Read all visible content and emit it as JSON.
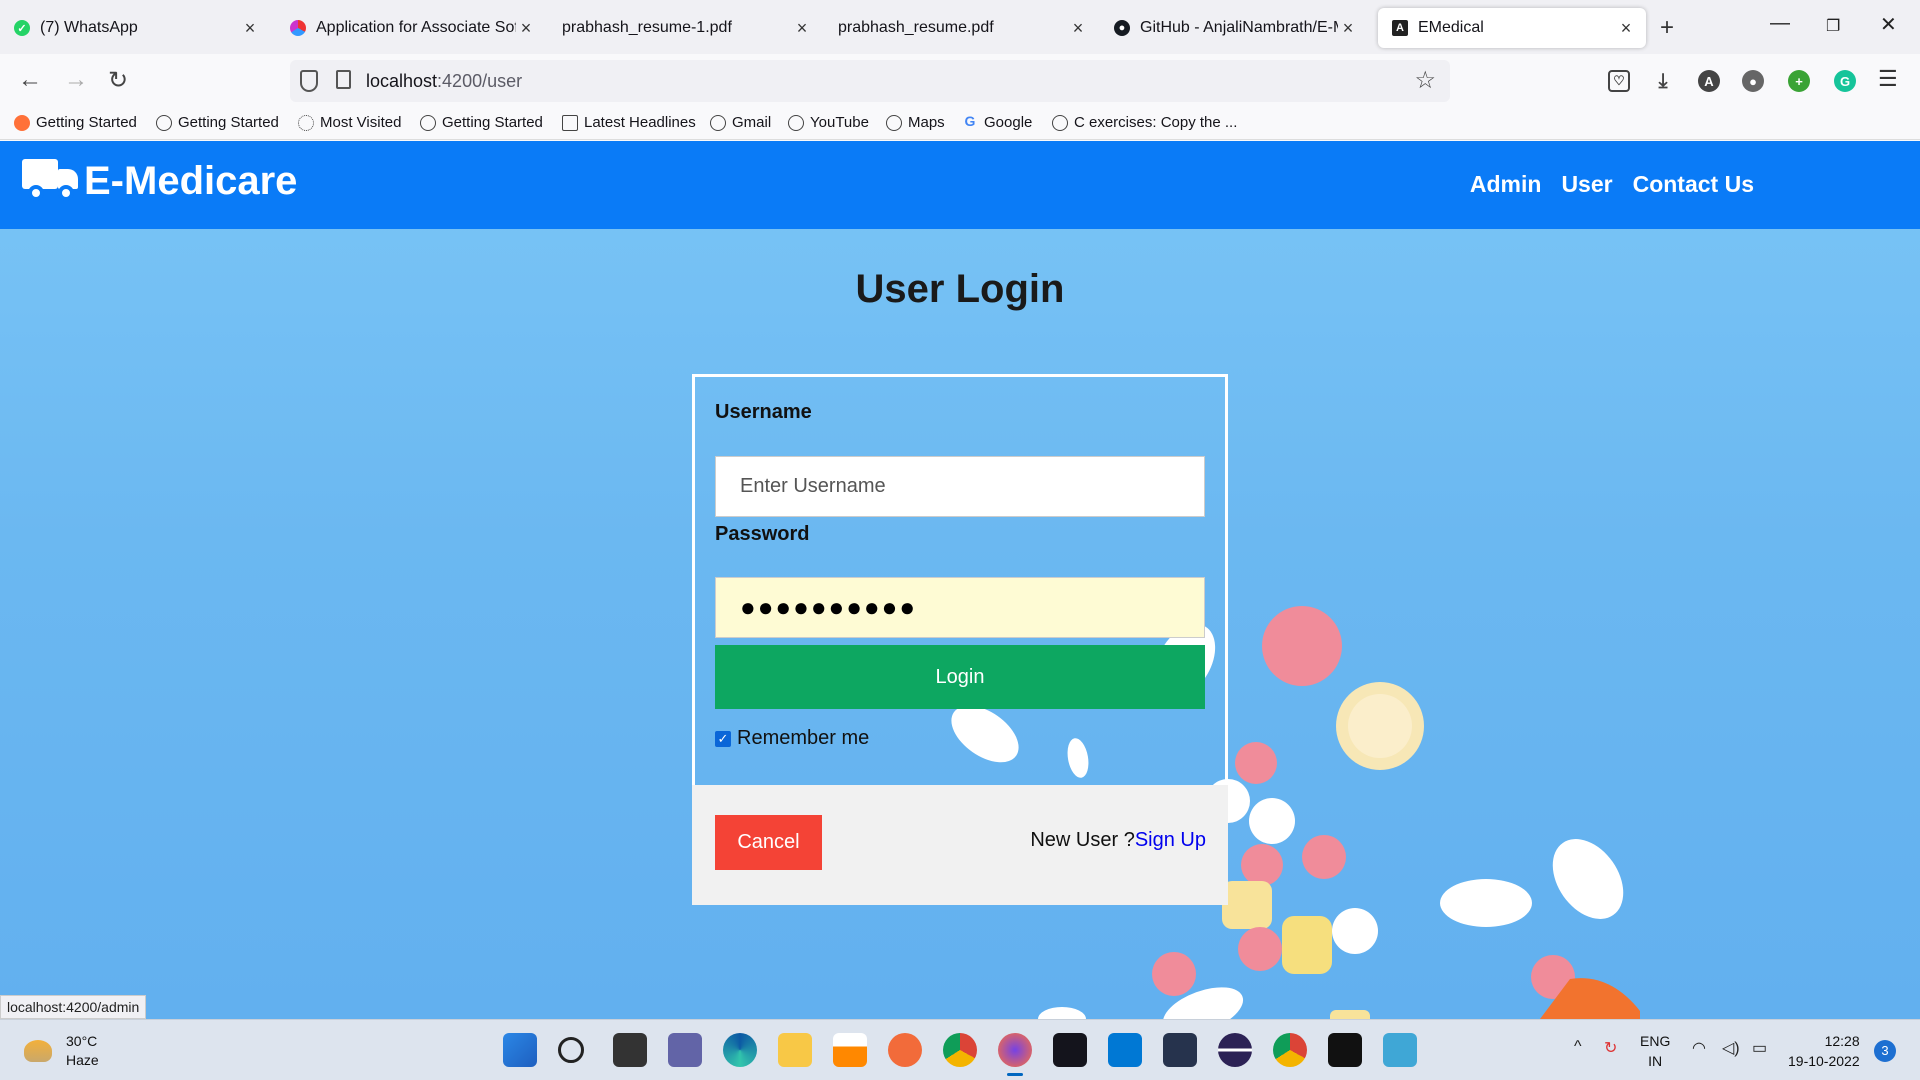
{
  "browser": {
    "tabs": [
      {
        "title": "(7) WhatsApp",
        "icon": "whatsapp-icon",
        "color": "#25d366"
      },
      {
        "title": "Application for Associate Softw",
        "icon": "apply-icon",
        "color": "#c93cbd"
      },
      {
        "title": "prabhash_resume-1.pdf",
        "icon": "",
        "color": ""
      },
      {
        "title": "prabhash_resume.pdf",
        "icon": "",
        "color": ""
      },
      {
        "title": "GitHub - AnjaliNambrath/E-Me",
        "icon": "github-icon",
        "color": "#161b22"
      },
      {
        "title": "EMedical",
        "icon": "angular-icon",
        "color": "#222"
      }
    ],
    "url_host": "localhost",
    "url_path": ":4200/user",
    "bookmarks": [
      "Getting Started",
      "Getting Started",
      "Most Visited",
      "Getting Started",
      "Latest Headlines",
      "Gmail",
      "YouTube",
      "Maps",
      "Google",
      "C exercises: Copy the ..."
    ],
    "status_url": "localhost:4200/admin"
  },
  "site": {
    "brand": "E-Medicare",
    "nav": [
      "Admin",
      "User",
      "Contact Us"
    ],
    "brand_color": "#0a7bf7"
  },
  "login": {
    "title": "User Login",
    "username_label": "Username",
    "username_placeholder": "Enter Username",
    "password_label": "Password",
    "password_value": "●●●●●●●●●●",
    "login_button": "Login",
    "remember_label": "Remember me",
    "remember_checked": true,
    "cancel_button": "Cancel",
    "new_user_text": "New User ?",
    "signup_link": "Sign Up",
    "login_color": "#0da761",
    "cancel_color": "#f44336"
  },
  "taskbar": {
    "weather_temp": "30°C",
    "weather_desc": "Haze",
    "lang_line1": "ENG",
    "lang_line2": "IN",
    "time": "12:28",
    "date": "19-10-2022",
    "notifications": "3"
  }
}
